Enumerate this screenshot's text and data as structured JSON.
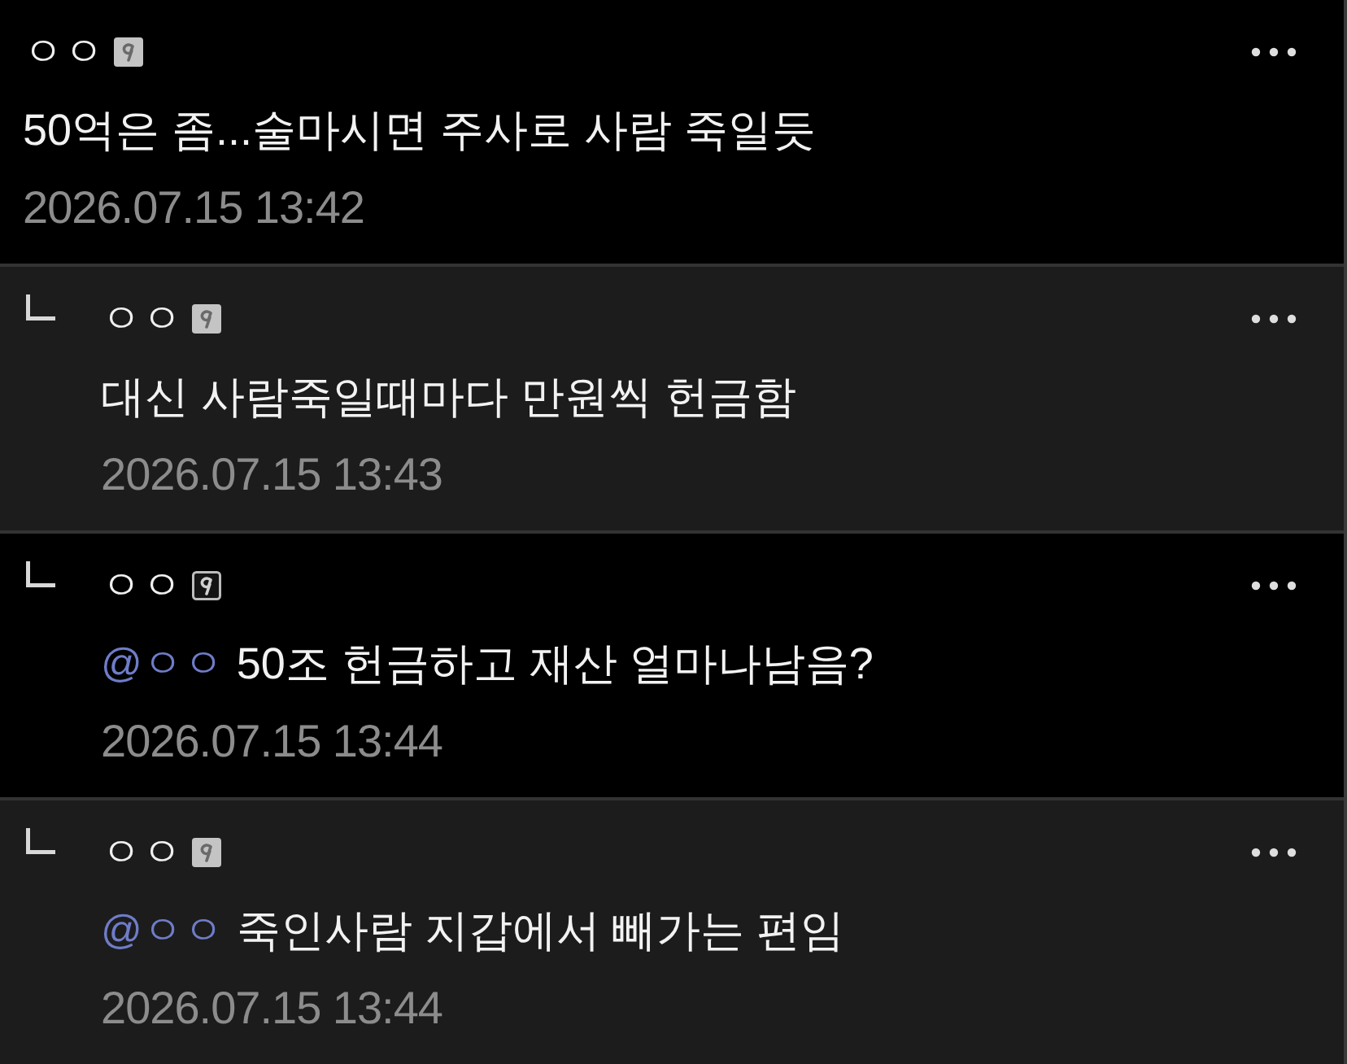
{
  "comments": [
    {
      "kind": "comment",
      "highlighted": false,
      "author": "ㅇㅇ",
      "badge_outlined": false,
      "text": "50억은 좀...술마시면 주사로 사람 죽일듯",
      "date": "2026.07.15 13:42"
    },
    {
      "kind": "reply",
      "highlighted": true,
      "author": "ㅇㅇ",
      "badge_outlined": false,
      "text": "대신 사람죽일때마다 만원씩 헌금함",
      "date": "2026.07.15 13:43"
    },
    {
      "kind": "reply",
      "highlighted": false,
      "author": "ㅇㅇ",
      "badge_outlined": true,
      "mention": "@ㅇㅇ",
      "text": "50조 헌금하고 재산 얼마나남음?",
      "date": "2026.07.15 13:44"
    },
    {
      "kind": "reply",
      "highlighted": true,
      "author": "ㅇㅇ",
      "badge_outlined": false,
      "mention": "@ㅇㅇ",
      "text": "죽인사람 지갑에서 빼가는 편임",
      "date": "2026.07.15 13:44"
    }
  ]
}
